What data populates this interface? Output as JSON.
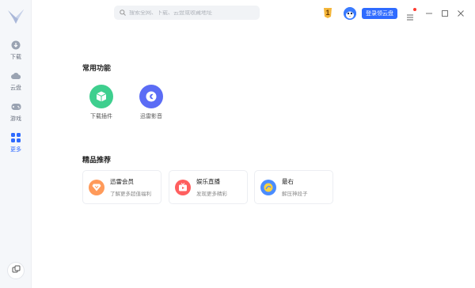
{
  "sidebar": {
    "items": [
      {
        "label": "下载",
        "icon": "download-icon"
      },
      {
        "label": "云盘",
        "icon": "cloud-icon"
      },
      {
        "label": "游戏",
        "icon": "gamepad-icon"
      },
      {
        "label": "更多",
        "icon": "grid-icon"
      }
    ],
    "active_color": "#2f6bff"
  },
  "topbar": {
    "search_placeholder": "搜索全网、下载、云盘或收藏地址",
    "rank_badge": "1",
    "cloud_button": "登录领云盘"
  },
  "main": {
    "common_title": "常用功能",
    "functions": [
      {
        "label": "下载插件",
        "icon": "cube-icon",
        "color": "#3ecf8e"
      },
      {
        "label": "迅雷影音",
        "icon": "player-icon",
        "color": "#5b6cf5"
      }
    ],
    "recommend_title": "精品推荐",
    "cards": [
      {
        "title": "迅雷会员",
        "subtitle": "了解更多超值福利",
        "icon": "diamond-icon",
        "color": "#ff9a5a"
      },
      {
        "title": "娱乐直播",
        "subtitle": "发现更多精彩",
        "icon": "tv-icon",
        "color": "#ff5f5f"
      },
      {
        "title": "最右",
        "subtitle": "解压神段子",
        "icon": "zuiyou-icon",
        "color": "#4a8cff"
      }
    ]
  }
}
